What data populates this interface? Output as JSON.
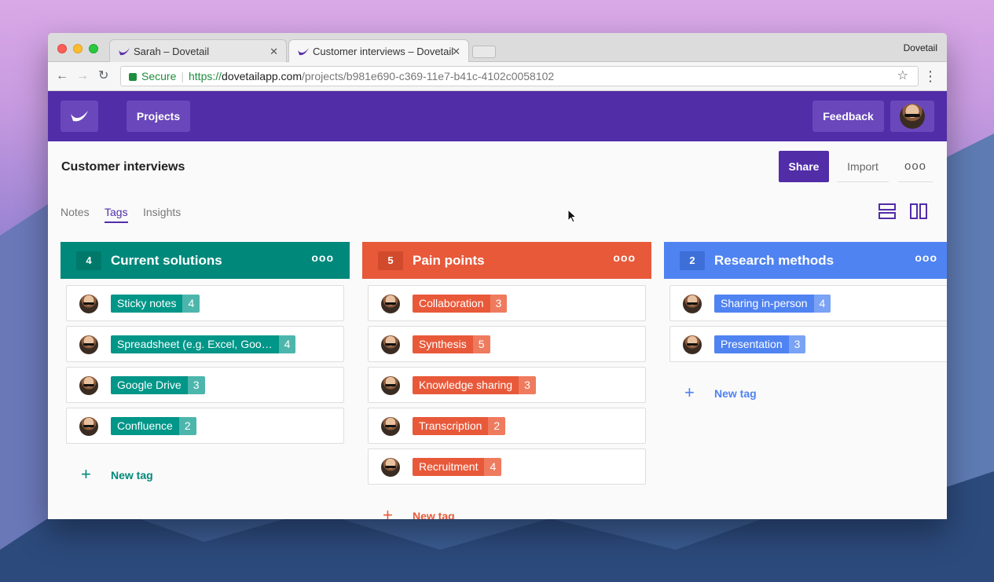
{
  "browser": {
    "tabs": [
      {
        "title": "Sarah – Dovetail",
        "active": false
      },
      {
        "title": "Customer interviews – Dovetail",
        "active": true
      }
    ],
    "profile": "Dovetail",
    "secure_label": "Secure",
    "url_scheme": "https://",
    "url_host": "dovetailapp.com",
    "url_path": "/projects/b981e690-c369-11e7-b41c-4102c0058102"
  },
  "header": {
    "projects_label": "Projects",
    "feedback_label": "Feedback",
    "brand_color": "#512da8"
  },
  "page": {
    "title": "Customer interviews",
    "share_label": "Share",
    "import_label": "Import",
    "more_label": "ooo",
    "tabs": [
      "Notes",
      "Tags",
      "Insights"
    ],
    "active_tab": "Tags"
  },
  "columns": [
    {
      "count": "4",
      "title": "Current solutions",
      "color": "#00897b",
      "count_bg": "#00796b",
      "pill_color": "#009688",
      "pill_count_color": "#4db6ac",
      "tags": [
        {
          "label": "Sticky notes",
          "count": "4"
        },
        {
          "label": "Spreadsheet (e.g. Excel, Goo…",
          "count": "4"
        },
        {
          "label": "Google Drive",
          "count": "3"
        },
        {
          "label": "Confluence",
          "count": "2"
        }
      ],
      "new_tag_label": "New tag"
    },
    {
      "count": "5",
      "title": "Pain points",
      "color": "#e8593a",
      "count_bg": "#d14a2c",
      "pill_color": "#e8593a",
      "pill_count_color": "#ef7b5f",
      "tags": [
        {
          "label": "Collaboration",
          "count": "3"
        },
        {
          "label": "Synthesis",
          "count": "5"
        },
        {
          "label": "Knowledge sharing",
          "count": "3"
        },
        {
          "label": "Transcription",
          "count": "2"
        },
        {
          "label": "Recruitment",
          "count": "4"
        }
      ],
      "new_tag_label": "New tag"
    },
    {
      "count": "2",
      "title": "Research methods",
      "color": "#4f83f1",
      "count_bg": "#3e6fd9",
      "pill_color": "#4f83f1",
      "pill_count_color": "#7aa2f5",
      "tags": [
        {
          "label": "Sharing in-person",
          "count": "4"
        },
        {
          "label": "Presentation",
          "count": "3"
        }
      ],
      "new_tag_label": "New tag"
    }
  ]
}
